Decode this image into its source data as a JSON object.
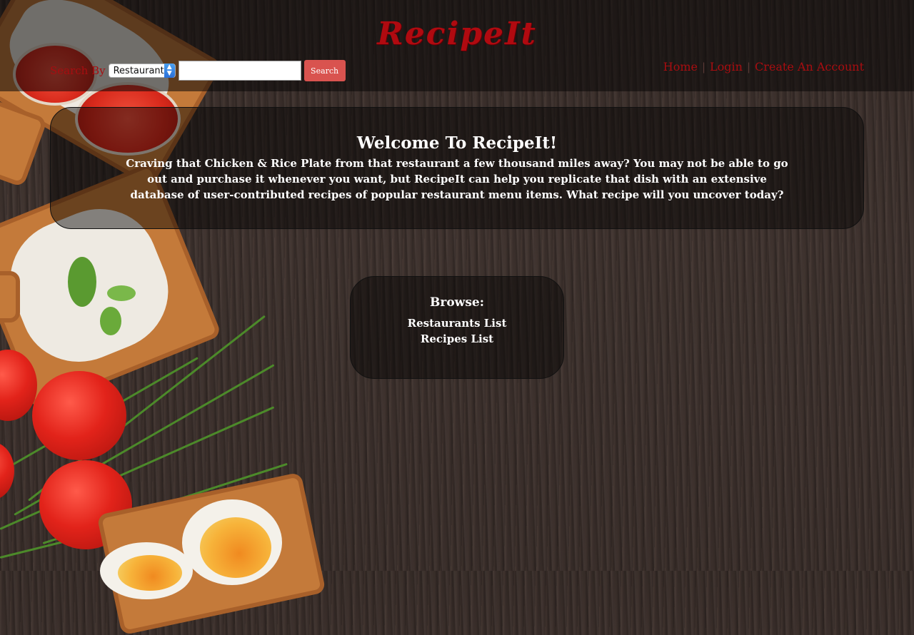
{
  "header": {
    "logo_text": "RecipeIt",
    "search": {
      "label": "Search By",
      "select_value": "Restaurant",
      "input_value": "",
      "button_label": "Search"
    },
    "nav": {
      "home": "Home",
      "login": "Login",
      "create_account": "Create An Account",
      "separator": "|"
    }
  },
  "welcome": {
    "title": "Welcome To RecipeIt!",
    "body": "Craving that Chicken & Rice Plate from that restaurant a few thousand miles away? You may not be able to go out and purchase it whenever you want, but RecipeIt can help you replicate that dish with an extensive database of user-contributed recipes of popular restaurant menu items. What recipe will you uncover today?"
  },
  "browse": {
    "title": "Browse:",
    "links": [
      "Restaurants List",
      "Recipes List"
    ]
  },
  "colors": {
    "brand_red": "#b00a10",
    "search_button": "#d9534f",
    "panel_bg": "rgba(0,0,0,0.45)"
  }
}
